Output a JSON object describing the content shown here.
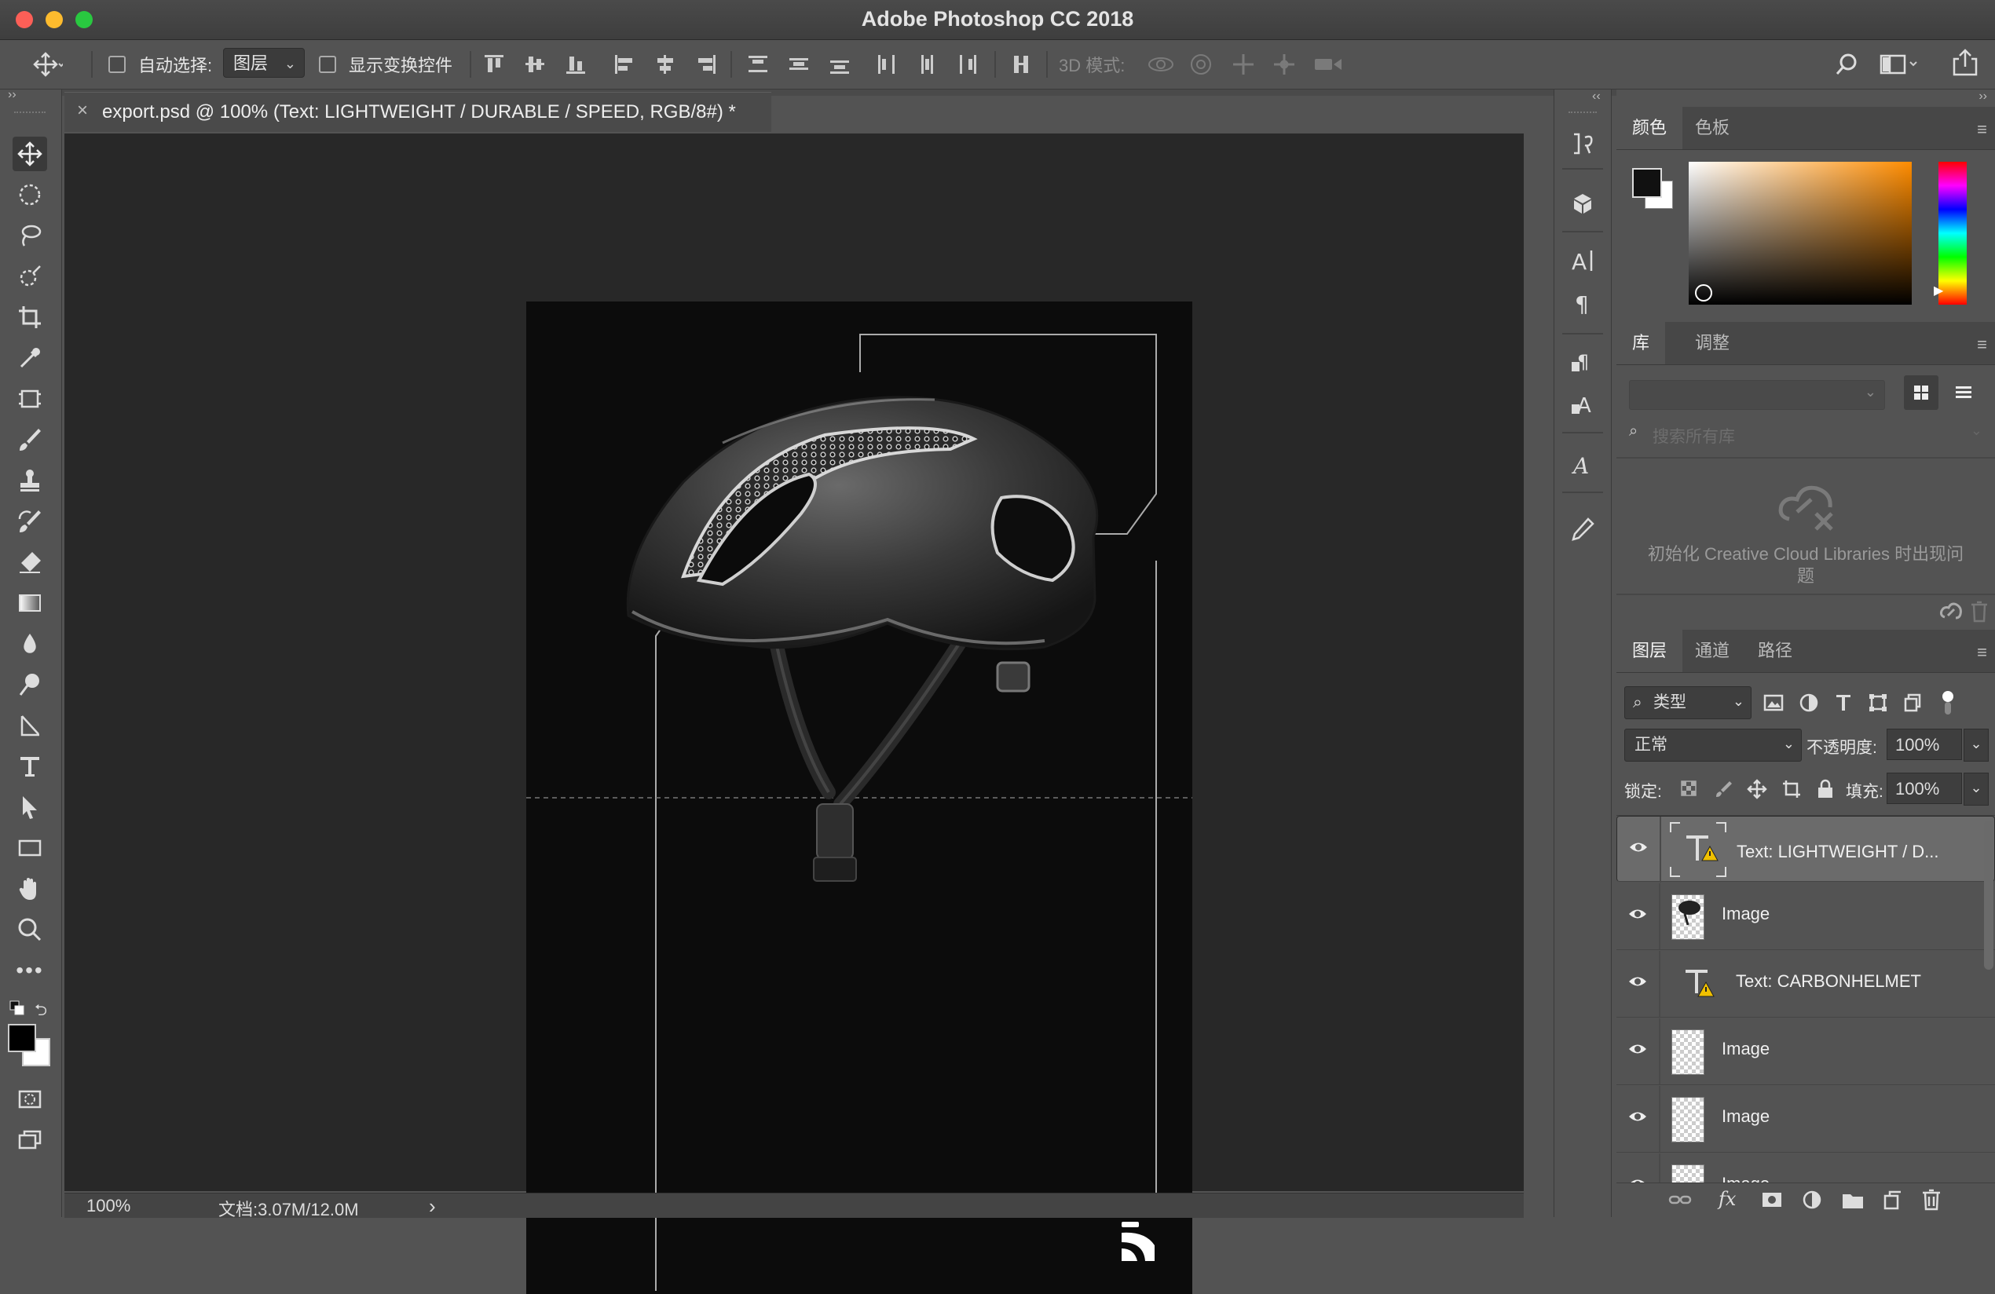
{
  "app": {
    "title": "Adobe Photoshop CC 2018",
    "traffic_lights": {
      "close": "#fc5f57",
      "minimize": "#fdbb2e",
      "zoom": "#29c840"
    }
  },
  "options_bar": {
    "move_icon": "move-icon",
    "auto_select_label": "自动选择:",
    "auto_select_value": "图层",
    "show_transform_label": "显示变换控件",
    "mode_3d_label": "3D 模式:"
  },
  "document": {
    "tab_title": "export.psd @ 100% (Text: LIGHTWEIGHT / DURABLE / SPEED, RGB/8#) *",
    "close_glyph": "×",
    "zoom": "100%",
    "doc_info": "文档:3.07M/12.0M",
    "status_arrow": "›"
  },
  "toolbar": {
    "tools": [
      "move-icon",
      "ellipse-marquee-icon",
      "lasso-icon",
      "quick-select-icon",
      "crop-icon",
      "eyedropper-icon",
      "frame-icon",
      "brush-icon",
      "stamp-icon",
      "history-brush-icon",
      "eraser-icon",
      "gradient-icon",
      "blur-icon",
      "dodge-icon",
      "pen-icon",
      "type-icon",
      "path-select-icon",
      "rectangle-icon",
      "hand-icon",
      "zoom-icon",
      "more-icon"
    ],
    "foreground_color": "#000000",
    "background_color": "#ffffff"
  },
  "color_panel": {
    "tabs": [
      "颜色",
      "色板"
    ],
    "active_tab": "颜色",
    "foreground": "#111111",
    "background": "#ffffff",
    "hue_color": "#ff8c00"
  },
  "library_panel": {
    "tabs": [
      "库",
      "调整"
    ],
    "active_tab": "库",
    "search_placeholder": "搜索所有库",
    "error_message": "初始化 Creative Cloud Libraries 时出现问题"
  },
  "layers_panel": {
    "tabs": [
      "图层",
      "通道",
      "路径"
    ],
    "active_tab": "图层",
    "filter_label": "类型",
    "blend_mode": "正常",
    "opacity_label": "不透明度:",
    "opacity_value": "100%",
    "lock_label": "锁定:",
    "fill_label": "填充:",
    "fill_value": "100%",
    "layers": [
      {
        "name": "Text: LIGHTWEIGHT / D...",
        "kind": "text",
        "selected": true
      },
      {
        "name": "Image",
        "kind": "image",
        "selected": false
      },
      {
        "name": "Text: CARBONHELMET",
        "kind": "text",
        "selected": false
      },
      {
        "name": "Image",
        "kind": "image",
        "selected": false
      },
      {
        "name": "Image",
        "kind": "image",
        "selected": false
      },
      {
        "name": "Image",
        "kind": "image",
        "selected": false
      }
    ]
  }
}
